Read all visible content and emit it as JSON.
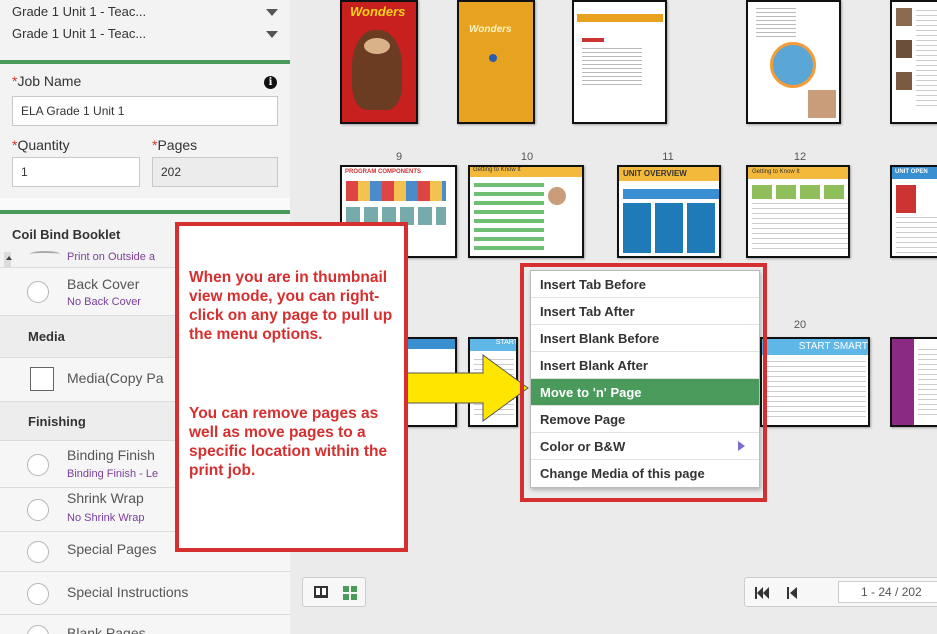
{
  "sidebar": {
    "dropdowns": [
      "Grade 1 Unit 1 - Teac...",
      "Grade 1 Unit 1 - Teac..."
    ],
    "job_name": {
      "label": "Job Name",
      "value": "ELA Grade 1 Unit 1"
    },
    "quantity": {
      "label": "Quantity",
      "value": "1"
    },
    "pages": {
      "label": "Pages",
      "value": "202"
    },
    "required_mark": "*",
    "binding_title": "Coil Bind Booklet",
    "print_outside": "Print on Outside a",
    "back_cover": {
      "name": "Back Cover",
      "value": "No Back Cover"
    },
    "media_title": "Media",
    "media_option": "Media(Copy Pa",
    "finishing_title": "Finishing",
    "binding_finish": {
      "name": "Binding Finish",
      "value": "Binding Finish - Le"
    },
    "shrink_wrap": {
      "name": "Shrink Wrap",
      "value": "No Shrink Wrap"
    },
    "special_pages": "Special Pages",
    "special_instructions": "Special Instructions",
    "blank_pages": "Blank Pages"
  },
  "thumbnails": {
    "page_numbers": [
      "9",
      "10",
      "11",
      "12",
      "20"
    ],
    "cover_title": "Wonders",
    "row2_headers": [
      "PROGRAM COMPONENTS",
      "Getting to Know It",
      "UNIT OVERVIEW",
      "Getting to Know It",
      "UNIT OPEN"
    ],
    "row3_headers": [
      "START",
      "START SMART"
    ]
  },
  "callout": {
    "para1": "When you are in thumbnail view mode, you can right-click on any page to pull up the menu options.",
    "para2": "You can remove pages as well as move pages to a specific location within the print job."
  },
  "context_menu": {
    "items": [
      "Insert Tab Before",
      "Insert Tab After",
      "Insert Blank Before",
      "Insert Blank After",
      "Move to 'n' Page",
      "Remove Page",
      "Color or B&W",
      "Change Media of this page"
    ],
    "highlighted_index": 4
  },
  "pagination": {
    "range": "1 - 24 / 202"
  },
  "colors": {
    "accent_green": "#4a9a5c",
    "callout_red": "#d62f2f",
    "arrow_yellow": "#ffe600",
    "option_purple": "#7b3f9c"
  },
  "icons": [
    "info-icon",
    "caret-down-icon",
    "book-view-icon",
    "grid-view-icon",
    "first-page-icon",
    "prev-page-icon",
    "submenu-arrow-icon"
  ]
}
